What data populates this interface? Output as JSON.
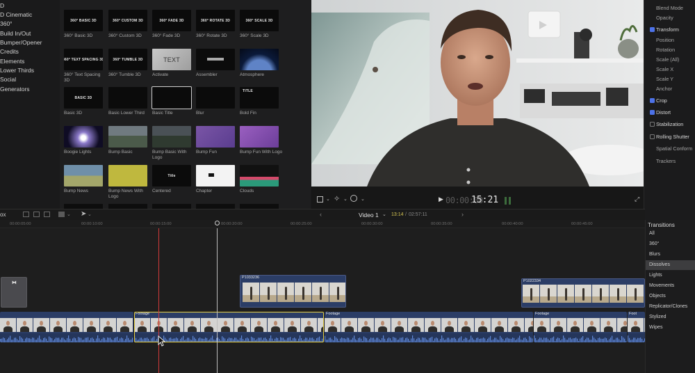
{
  "sidebar": {
    "items": [
      "D",
      "D Cinematic",
      "360°",
      "Build In/Out",
      "Bumper/Opener",
      "Credits",
      "Elements",
      "Lower Thirds",
      "Social",
      "Generators"
    ]
  },
  "browser": {
    "tiles": [
      {
        "caption": "360° Basic 3D",
        "thumb_text": "360° BASIC 3D",
        "style": "black"
      },
      {
        "caption": "360° Custom 3D",
        "thumb_text": "360° CUSTOM 3D",
        "style": "black"
      },
      {
        "caption": "360° Fade 3D",
        "thumb_text": "360° FADE 3D",
        "style": "black"
      },
      {
        "caption": "360° Rotate 3D",
        "thumb_text": "360° ROTATE 3D",
        "style": "black"
      },
      {
        "caption": "360° Scale 3D",
        "thumb_text": "360° SCALE 3D",
        "style": "black"
      },
      {
        "caption": "360° Text Spacing 3D",
        "thumb_text": "360° TEXT SPACING 3D",
        "style": "black"
      },
      {
        "caption": "360° Tumble 3D",
        "thumb_text": "360° TUMBLE 3D",
        "style": "black"
      },
      {
        "caption": "Activate",
        "thumb_text": "TEXT",
        "style": "activate"
      },
      {
        "caption": "Assembler",
        "thumb_text": "",
        "style": "assembler"
      },
      {
        "caption": "Atmosphere",
        "thumb_text": "",
        "style": "atmosphere"
      },
      {
        "caption": "Basic 3D",
        "thumb_text": "BASIC 3D",
        "style": "black"
      },
      {
        "caption": "Basic Lower Third",
        "thumb_text": "",
        "style": "black"
      },
      {
        "caption": "Basic Title",
        "thumb_text": "",
        "style": "selected"
      },
      {
        "caption": "Blur",
        "thumb_text": "",
        "style": "black"
      },
      {
        "caption": "Bold Fin",
        "thumb_text": "TITLE",
        "style": "boldfin"
      },
      {
        "caption": "Boogie Lights",
        "thumb_text": "",
        "style": "boogie"
      },
      {
        "caption": "Bump Basic",
        "thumb_text": "",
        "style": "mountain"
      },
      {
        "caption": "Bump Basic With Logo",
        "thumb_text": "",
        "style": "mountain-dark"
      },
      {
        "caption": "Bump Fun",
        "thumb_text": "",
        "style": "purple"
      },
      {
        "caption": "Bump Fun With Logo",
        "thumb_text": "",
        "style": "purple-logo"
      },
      {
        "caption": "Bump News",
        "thumb_text": "",
        "style": "news"
      },
      {
        "caption": "Bump News With Logo",
        "thumb_text": "",
        "style": "yellow"
      },
      {
        "caption": "Centered",
        "thumb_text": "Title",
        "style": "black"
      },
      {
        "caption": "Chapter",
        "thumb_text": "",
        "style": "white"
      },
      {
        "caption": "Clouds",
        "thumb_text": "",
        "style": "clouds"
      }
    ]
  },
  "viewer": {
    "timecode": "15:21",
    "timecode_prefix": "00:00:00"
  },
  "inspector": {
    "rows": [
      {
        "label": "Blend Mode",
        "check": "none"
      },
      {
        "label": "Opacity",
        "check": "none"
      },
      {
        "label": "Transform",
        "check": "on"
      },
      {
        "label": "Position",
        "check": "none"
      },
      {
        "label": "Rotation",
        "check": "none"
      },
      {
        "label": "Scale (All)",
        "check": "none"
      },
      {
        "label": "Scale X",
        "check": "none"
      },
      {
        "label": "Scale Y",
        "check": "none"
      },
      {
        "label": "Anchor",
        "check": "none"
      },
      {
        "label": "Crop",
        "check": "on"
      },
      {
        "label": "Distort",
        "check": "on"
      },
      {
        "label": "Stabilization",
        "check": "off"
      },
      {
        "label": "Rolling Shutter",
        "check": "off"
      },
      {
        "label": "Spatial Conform",
        "check": "none"
      },
      {
        "label": "Trackers",
        "check": "none"
      }
    ]
  },
  "timeline": {
    "project_name": "Video 1",
    "position": "13:14",
    "duration": "02:57:11",
    "toolbar_label": "ox",
    "ruler": [
      "00:00:05:00",
      "00:00:10:00",
      "00:00:15:00",
      "00:00:20:00",
      "00:00:25:00",
      "00:00:30:00",
      "00:00:35:00",
      "00:00:40:00",
      "00:00:45:00"
    ],
    "clips": {
      "connected_1": "P1033236",
      "connected_2": "P1022334",
      "footage": [
        "Footage",
        "Footage",
        "Footage",
        "Foot"
      ]
    }
  },
  "transitions": {
    "header": "Transitions",
    "items": [
      "All",
      "360°",
      "Blurs",
      "Dissolves",
      "Lights",
      "Movements",
      "Objects",
      "Replicator/Clones",
      "Stylized",
      "Wipes"
    ],
    "selected_index": 3
  },
  "colors": {
    "accent_blue": "#4d72e8",
    "selection_yellow": "#e7d24a",
    "playhead_red": "#d13a3a",
    "clip_blue": "#2b3d66",
    "audio_blue": "#3a5faa"
  }
}
